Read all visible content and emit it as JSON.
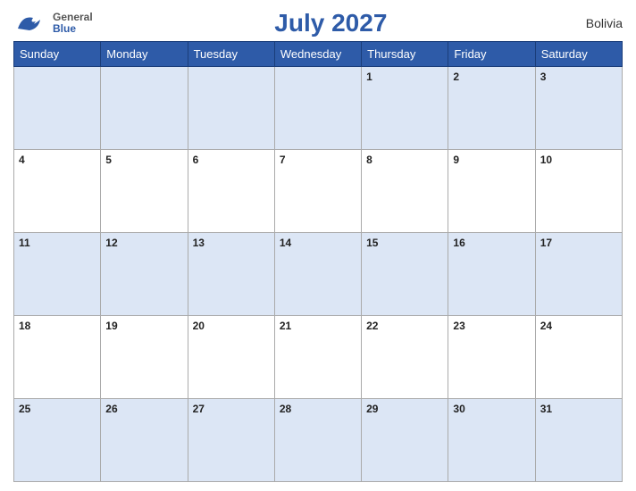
{
  "header": {
    "title": "July 2027",
    "country": "Bolivia",
    "logo": {
      "general": "General",
      "blue": "Blue"
    }
  },
  "days_of_week": [
    "Sunday",
    "Monday",
    "Tuesday",
    "Wednesday",
    "Thursday",
    "Friday",
    "Saturday"
  ],
  "weeks": [
    [
      null,
      null,
      null,
      null,
      1,
      2,
      3
    ],
    [
      4,
      5,
      6,
      7,
      8,
      9,
      10
    ],
    [
      11,
      12,
      13,
      14,
      15,
      16,
      17
    ],
    [
      18,
      19,
      20,
      21,
      22,
      23,
      24
    ],
    [
      25,
      26,
      27,
      28,
      29,
      30,
      31
    ]
  ]
}
